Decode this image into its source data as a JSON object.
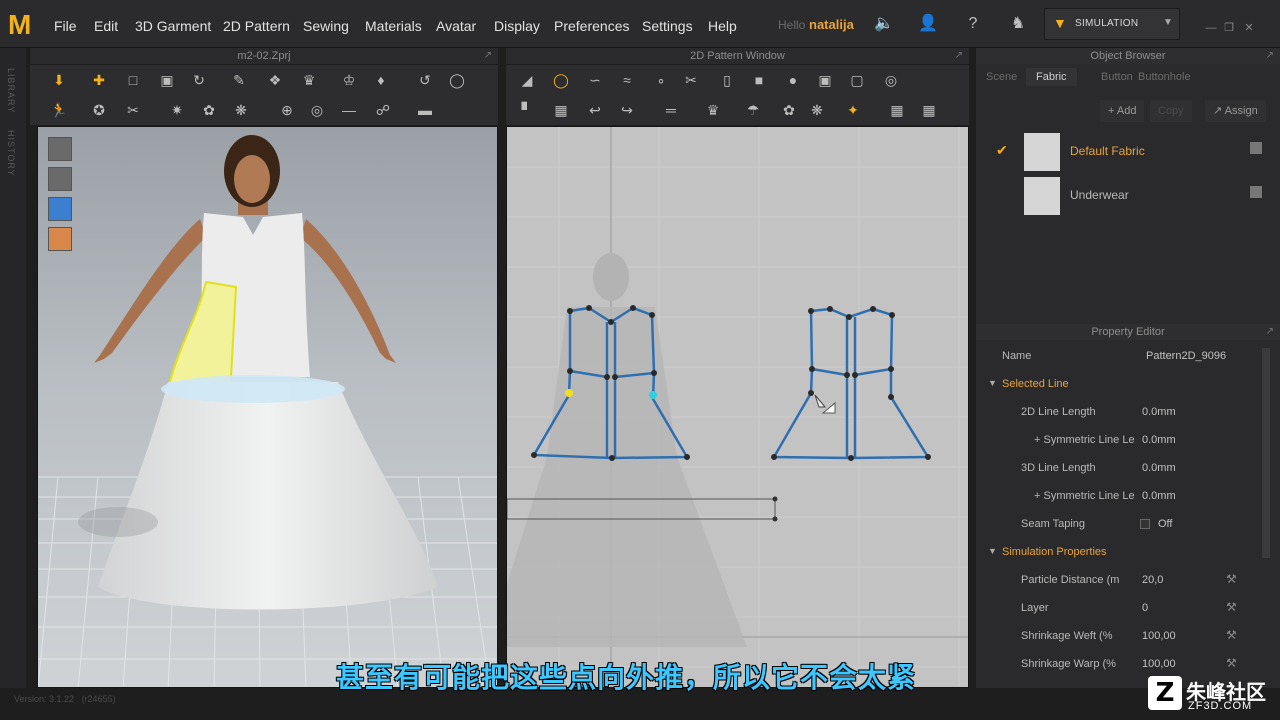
{
  "app": {
    "logo_letter": "M"
  },
  "menu": [
    "File",
    "Edit",
    "3D Garment",
    "2D Pattern",
    "Sewing",
    "Materials",
    "Avatar",
    "Display",
    "Preferences",
    "Settings",
    "Help"
  ],
  "user": {
    "hello": "Hello",
    "name": "natalija"
  },
  "simulation": {
    "label": "SIMULATION"
  },
  "left_sidebar": {
    "tabs": [
      "LIBRARY",
      "HISTORY"
    ]
  },
  "view3d": {
    "title": "m2-02.Zprj"
  },
  "view2d": {
    "title": "2D Pattern Window"
  },
  "object_browser": {
    "title": "Object Browser",
    "tabs": [
      "Scene",
      "Fabric",
      "Button",
      "Buttonhole"
    ],
    "active_tab": "Fabric",
    "buttons": {
      "add": "Add",
      "copy": "Copy",
      "assign": "Assign"
    },
    "fabrics": [
      {
        "name": "Default Fabric",
        "selected": true
      },
      {
        "name": "Underwear",
        "selected": false
      }
    ]
  },
  "property_editor": {
    "title": "Property Editor",
    "name_label": "Name",
    "name_value": "Pattern2D_9096",
    "selected_line": {
      "section": "Selected Line",
      "rows": [
        {
          "label": "2D Line Length",
          "value": "0.0mm"
        },
        {
          "label": "+ Symmetric Line Le",
          "value": "0.0mm"
        },
        {
          "label": "3D Line Length",
          "value": "0.0mm"
        },
        {
          "label": "+ Symmetric Line Le",
          "value": "0.0mm"
        },
        {
          "label": "Seam Taping",
          "value": "Off"
        }
      ]
    },
    "simulation_properties": {
      "section": "Simulation Properties",
      "rows": [
        {
          "label": "Particle Distance (m",
          "value": "20,0"
        },
        {
          "label": "Layer",
          "value": "0"
        },
        {
          "label": "Shrinkage Weft (%",
          "value": "100,00"
        },
        {
          "label": "Shrinkage Warp (%",
          "value": "100,00"
        }
      ]
    }
  },
  "status": {
    "version": "Version: 3.1.22",
    "build": "(r24655)"
  },
  "subtitle": "甚至有可能把这些点向外推，所以它不会太紧",
  "watermark": {
    "letter": "Z",
    "name": "朱峰社区",
    "url": "ZF3D.COM"
  },
  "colors": {
    "accent": "#f4b21a",
    "pattern_line": "#5aa0d8",
    "subtitle": "#3ec6ff",
    "section": "#e8a33c"
  }
}
